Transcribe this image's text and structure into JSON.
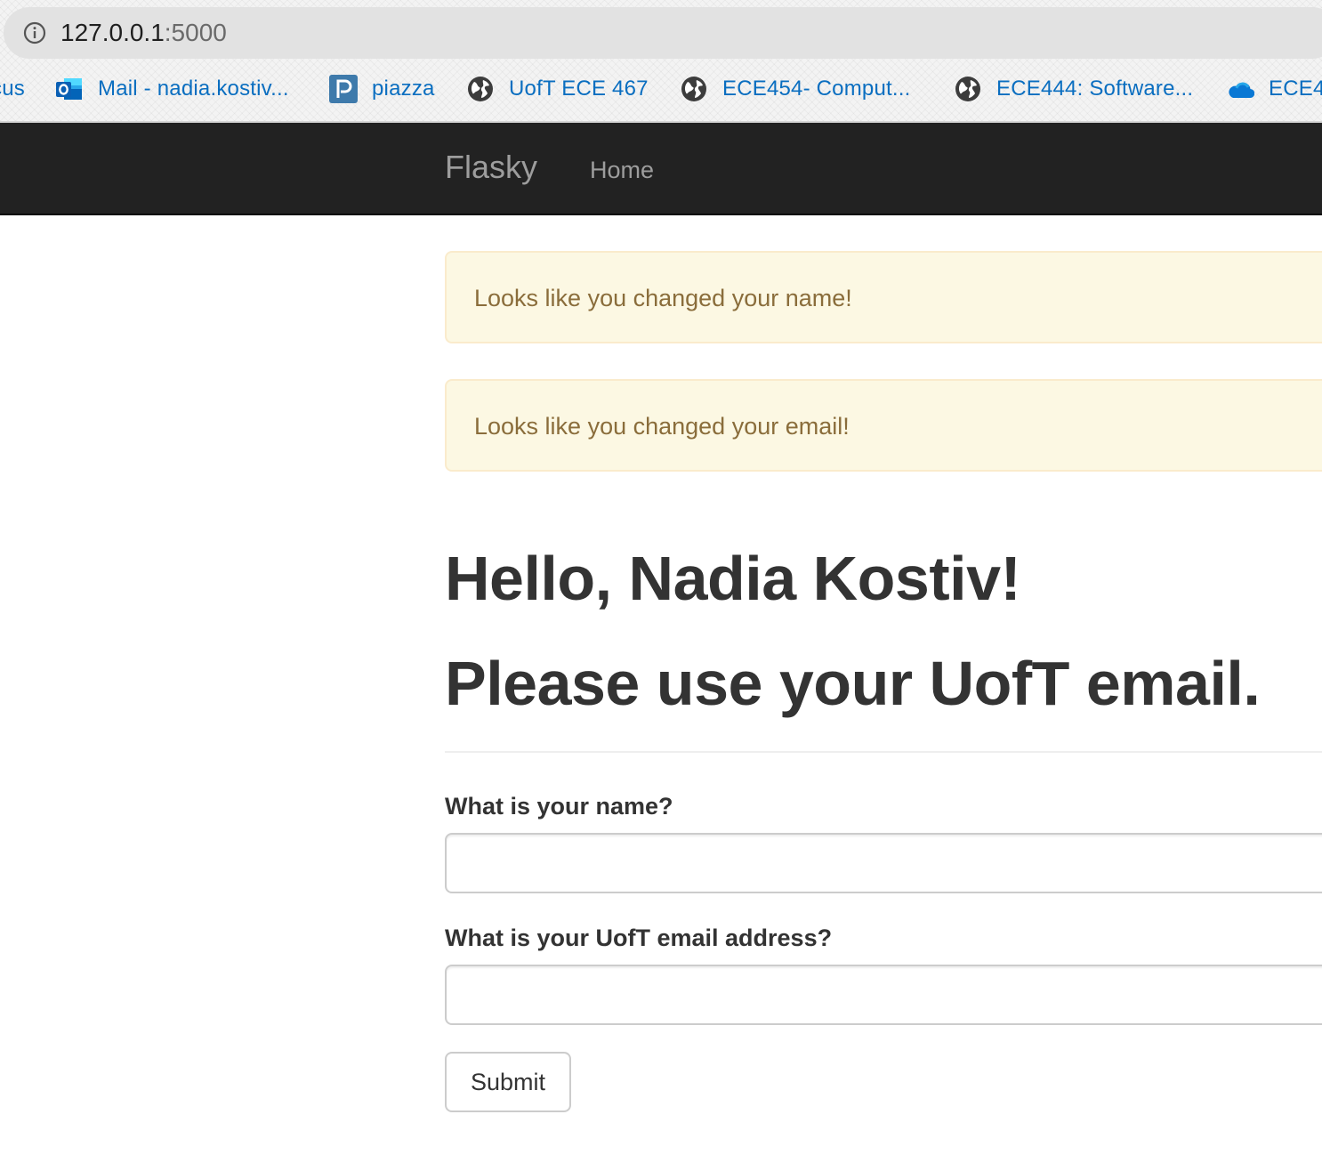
{
  "browser": {
    "url_host": "127.0.0.1",
    "url_port": ":5000",
    "bookmarks": [
      {
        "label": "cus",
        "icon": "globe-icon"
      },
      {
        "label": "Mail - nadia.kostiv...",
        "icon": "outlook-icon"
      },
      {
        "label": "piazza",
        "icon": "piazza-icon"
      },
      {
        "label": "UofT ECE 467",
        "icon": "globe-icon"
      },
      {
        "label": "ECE454- Comput...",
        "icon": "globe-icon"
      },
      {
        "label": "ECE444: Software...",
        "icon": "globe-icon"
      },
      {
        "label": "ECE4",
        "icon": "onedrive-icon"
      }
    ]
  },
  "navbar": {
    "brand": "Flasky",
    "links": [
      "Home"
    ]
  },
  "alerts": [
    "Looks like you changed your name!",
    "Looks like you changed your email!"
  ],
  "header": {
    "greeting": "Hello, Nadia Kostiv!",
    "notice": "Please use your UofT email."
  },
  "form": {
    "name_label": "What is your name?",
    "name_value": "",
    "email_label": "What is your UofT email address?",
    "email_value": "",
    "submit_label": "Submit"
  },
  "colors": {
    "navbar_bg": "#222222",
    "navbar_text": "#9d9d9d",
    "alert_bg": "#fcf8e3",
    "alert_border": "#faebcc",
    "alert_text": "#8a6d3b",
    "bookmark_text": "#0a6ec0",
    "heading_text": "#333333"
  }
}
